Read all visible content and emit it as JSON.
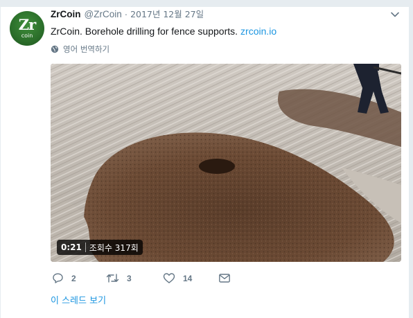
{
  "tweet": {
    "avatar": {
      "big": "Zr",
      "small": "coin"
    },
    "author_name": "ZrCoin",
    "author_handle": "@ZrCoin",
    "separator": "·",
    "date": "2017년 12월 27일",
    "text": "ZrCoin. Borehole drilling for fence supports.",
    "link": "zrcoin.io",
    "translate_label": "영어 번역하기",
    "video": {
      "time": "0:21",
      "views": "조회수 317회"
    },
    "actions": {
      "reply_count": "2",
      "retweet_count": "3",
      "like_count": "14"
    },
    "thread_label": "이 스레드 보기"
  },
  "colors": {
    "link": "#1b95e0",
    "muted": "#657786",
    "background": "#e6ecf0",
    "avatar": "#2b6e2a"
  },
  "icons": [
    "chevron-down-icon",
    "globe-icon",
    "reply-icon",
    "retweet-icon",
    "like-icon",
    "message-icon"
  ]
}
